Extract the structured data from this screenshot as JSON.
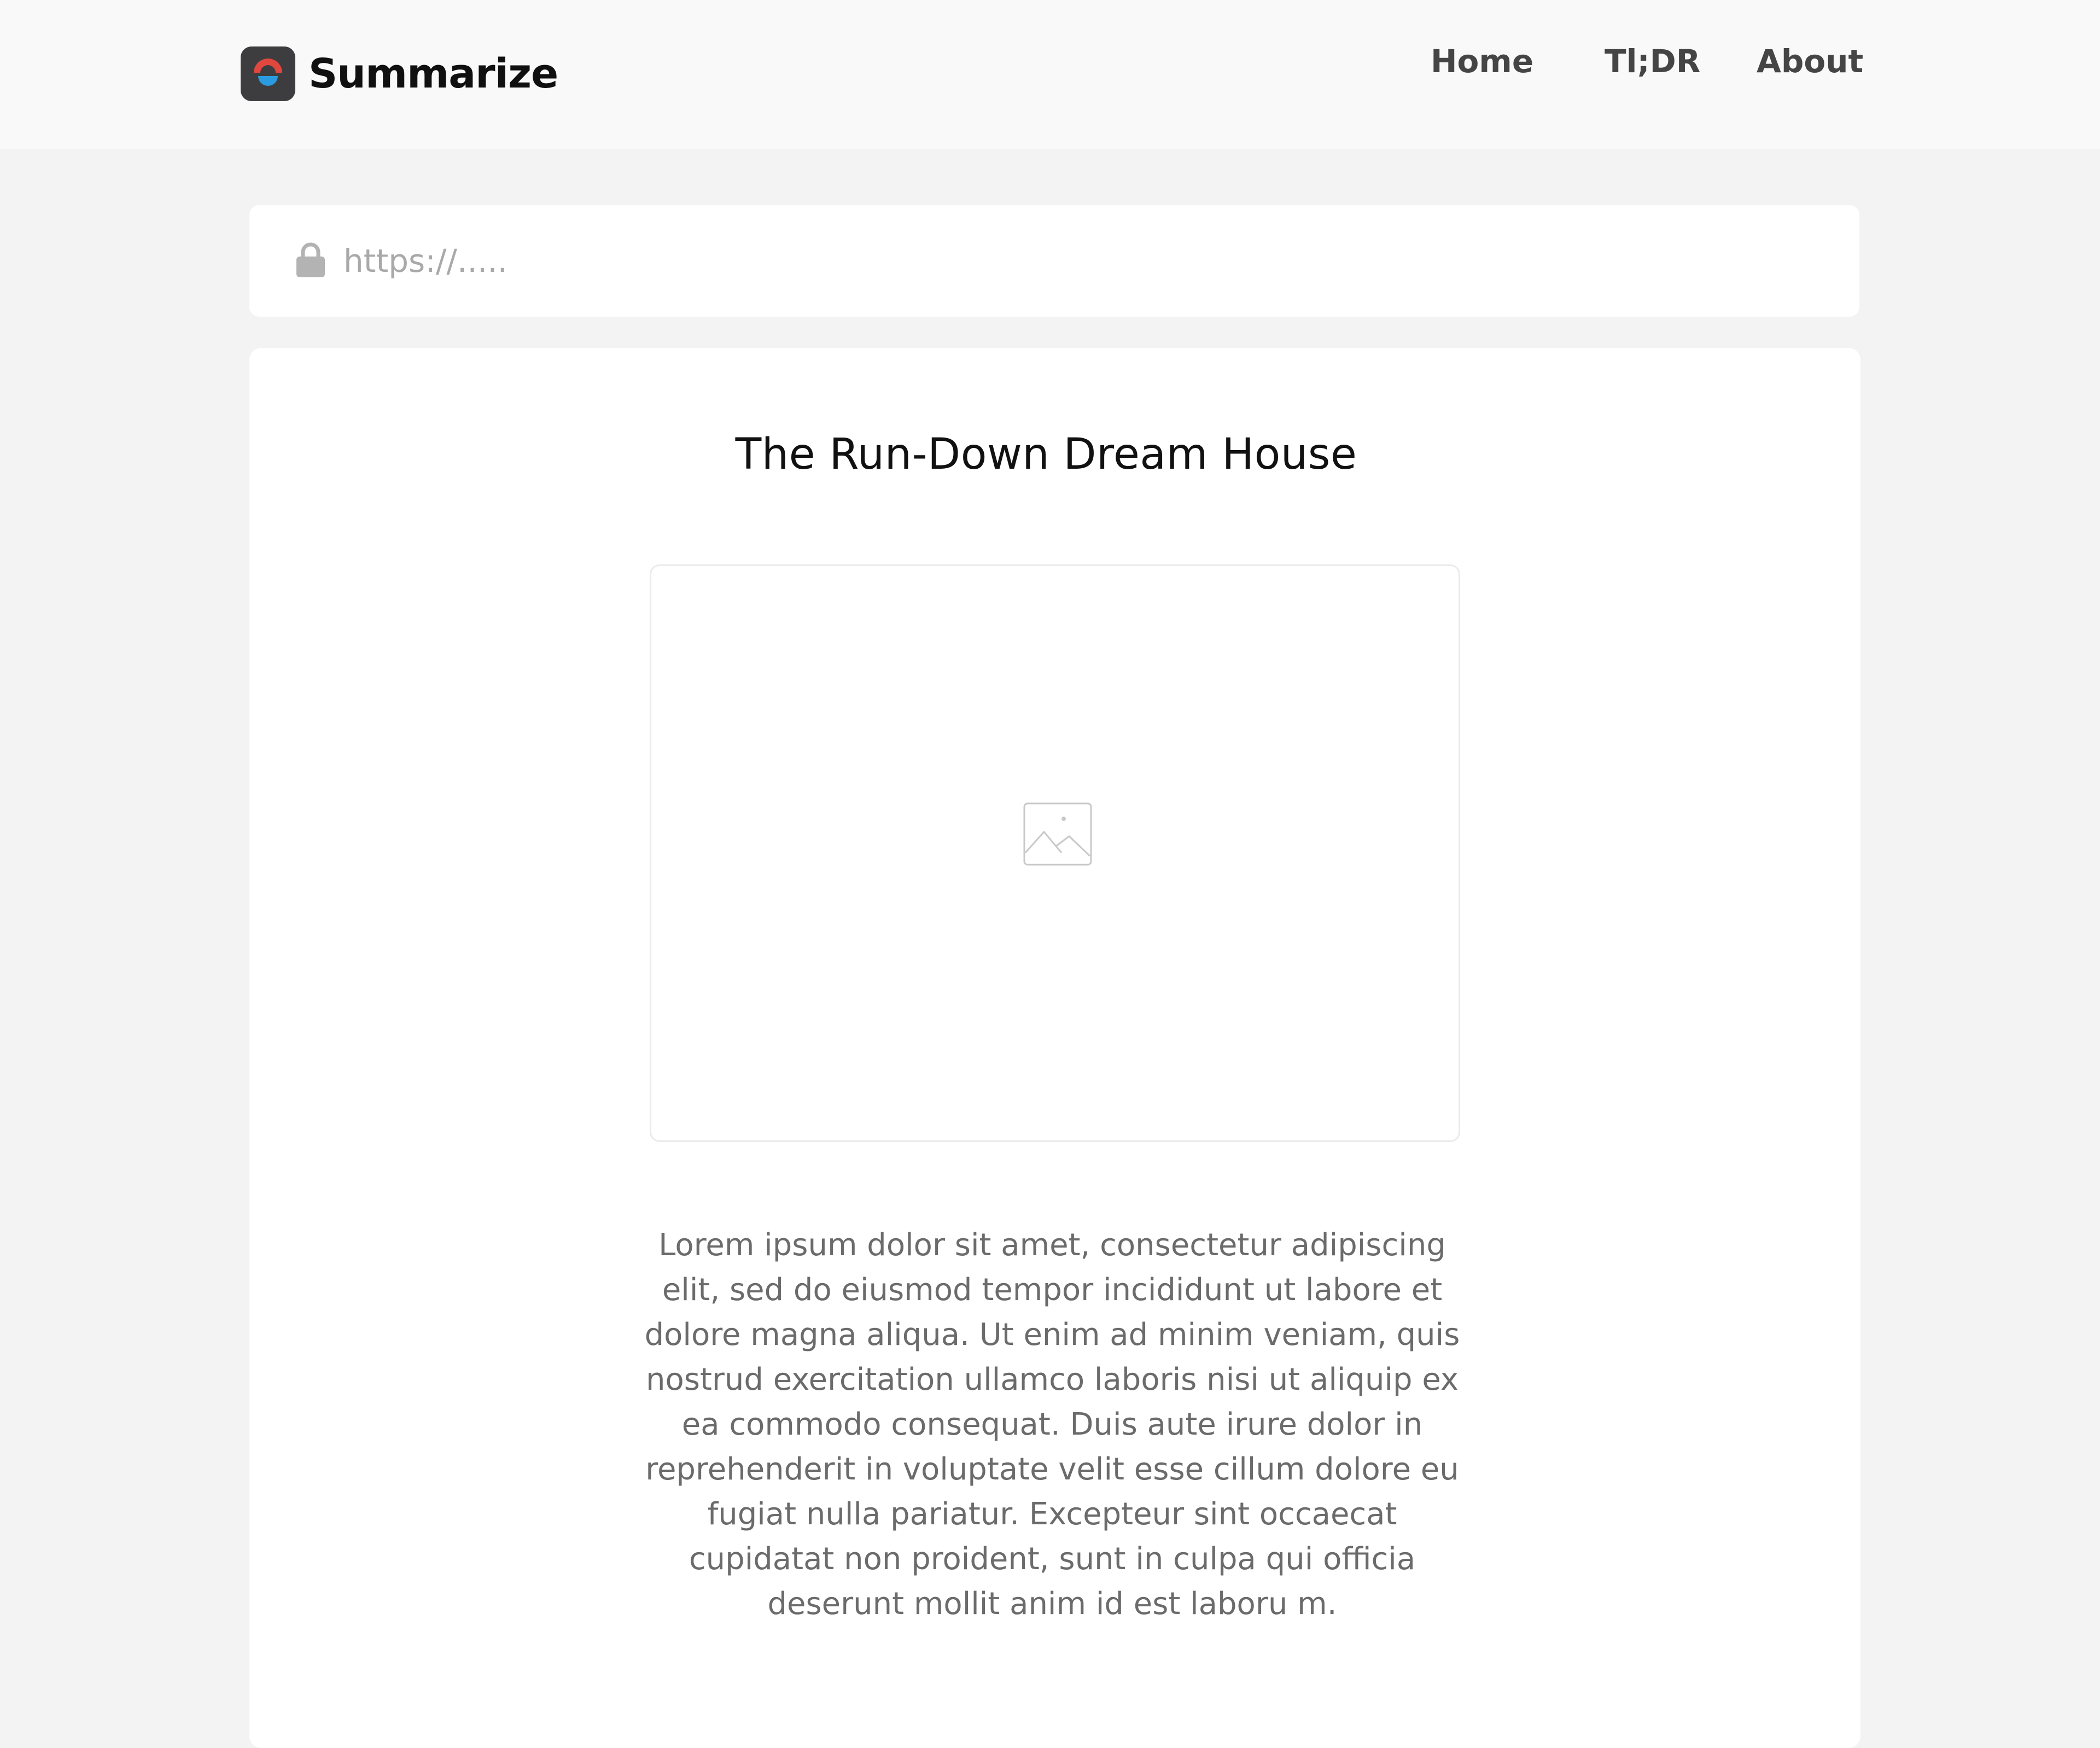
{
  "brand": {
    "name": "Summarize",
    "logo_colors": {
      "top": "#e0473f",
      "bottom": "#2b9be0",
      "background": "#3d3d3f"
    }
  },
  "nav": {
    "items": [
      {
        "label": "Home"
      },
      {
        "label": "Tl;DR"
      },
      {
        "label": "About"
      }
    ]
  },
  "url_bar": {
    "icon": "lock-icon",
    "placeholder": "https://.....",
    "value": ""
  },
  "article": {
    "title": "The Run-Down Dream House",
    "image_icon": "image-placeholder-icon",
    "body": "Lorem ipsum dolor sit amet, consectetur adipiscing elit, sed do eiusmod tempor incididunt ut labore et dolore magna aliqua. Ut enim ad minim veniam, quis nostrud exercitation ullamco laboris nisi ut aliquip ex ea commodo consequat. Duis aute irure dolor in reprehenderit in voluptate velit esse cillum dolore eu fugiat nulla pariatur. Excepteur sint occaecat cupidatat non proident, sunt in culpa qui officia deserunt mollit anim id est laboru m."
  },
  "colors": {
    "page_background": "#f3f3f3",
    "header_background": "#f9f9f9",
    "card_background": "#ffffff",
    "nav_text": "#454545",
    "body_text": "#6b6b6b"
  }
}
